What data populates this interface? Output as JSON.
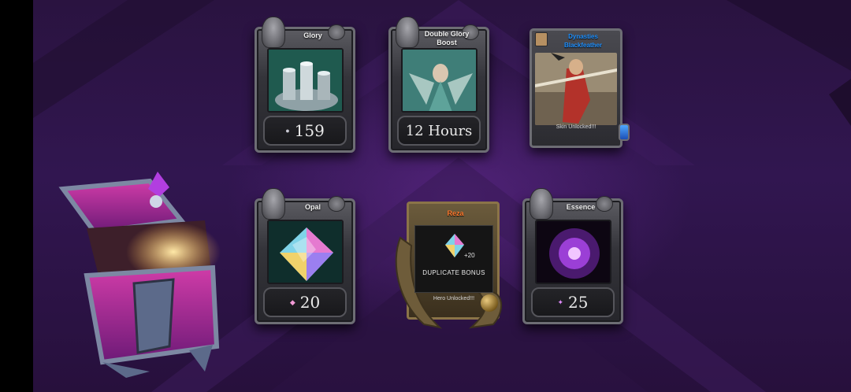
{
  "rewards": {
    "glory": {
      "title": "Glory",
      "value": "159",
      "icon": "glory-coin-icon"
    },
    "boost": {
      "title": "Double Glory Boost",
      "value": "12 Hours"
    },
    "skin": {
      "title": "Dynasties Blackfeather",
      "note": "Skin Unlocked!!!"
    },
    "opal": {
      "title": "Opal",
      "value": "20",
      "icon": "opal-gem-icon"
    },
    "hero": {
      "title": "Reza",
      "bonus_count": "+20",
      "bonus_label": "DUPLICATE BONUS",
      "note": "Hero Unlocked!!!"
    },
    "essence": {
      "title": "Essence",
      "value": "25",
      "icon": "essence-icon"
    }
  },
  "colors": {
    "skin_title": "#1e90ff",
    "hero_title": "#ff7a2e",
    "background": "#2a1340"
  }
}
